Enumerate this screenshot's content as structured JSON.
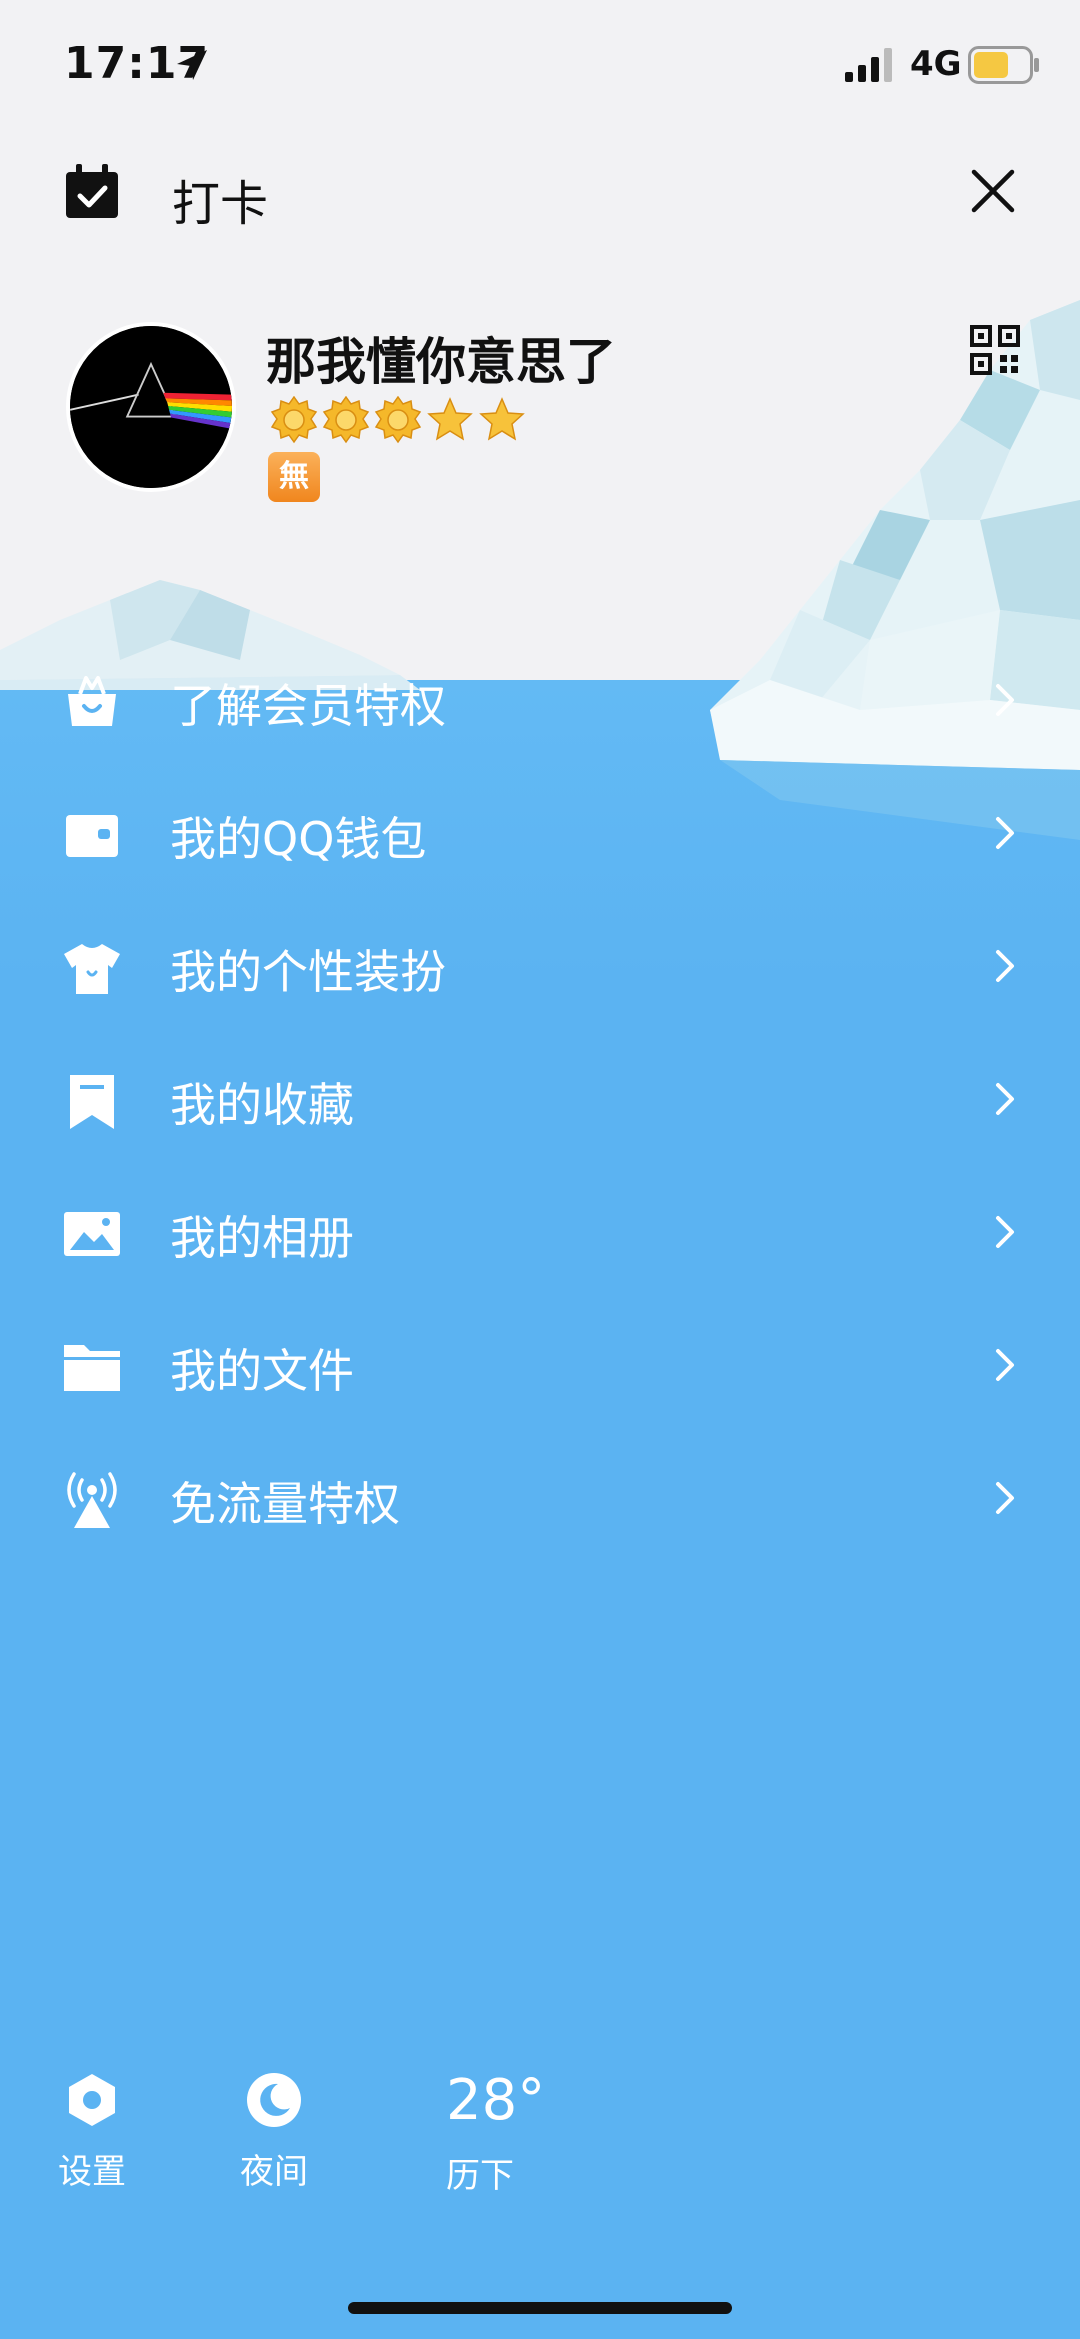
{
  "status_bar": {
    "time": "17:17",
    "network": "4G"
  },
  "header": {
    "checkin_label": "打卡"
  },
  "profile": {
    "nickname": "那我懂你意思了",
    "badge_text": "無",
    "level_icons": [
      "sun-icon",
      "sun-icon",
      "sun-icon",
      "star-icon",
      "star-icon"
    ]
  },
  "menu": {
    "items": [
      {
        "label": "了解会员特权",
        "icon": "vip-bag-icon"
      },
      {
        "label": "我的QQ钱包",
        "icon": "wallet-icon"
      },
      {
        "label": "我的个性装扮",
        "icon": "tshirt-icon"
      },
      {
        "label": "我的收藏",
        "icon": "bookmark-icon"
      },
      {
        "label": "我的相册",
        "icon": "photo-icon"
      },
      {
        "label": "我的文件",
        "icon": "folder-icon"
      },
      {
        "label": "免流量特权",
        "icon": "signal-tower-icon"
      }
    ]
  },
  "bottom": {
    "settings_label": "设置",
    "night_label": "夜间",
    "weather_temp": "28°",
    "weather_city": "历下"
  },
  "colors": {
    "sea": "#5BB3F2",
    "top_background": "#F2F2F4",
    "badge": "#F59A2E",
    "battery_fill": "#F5C842"
  }
}
